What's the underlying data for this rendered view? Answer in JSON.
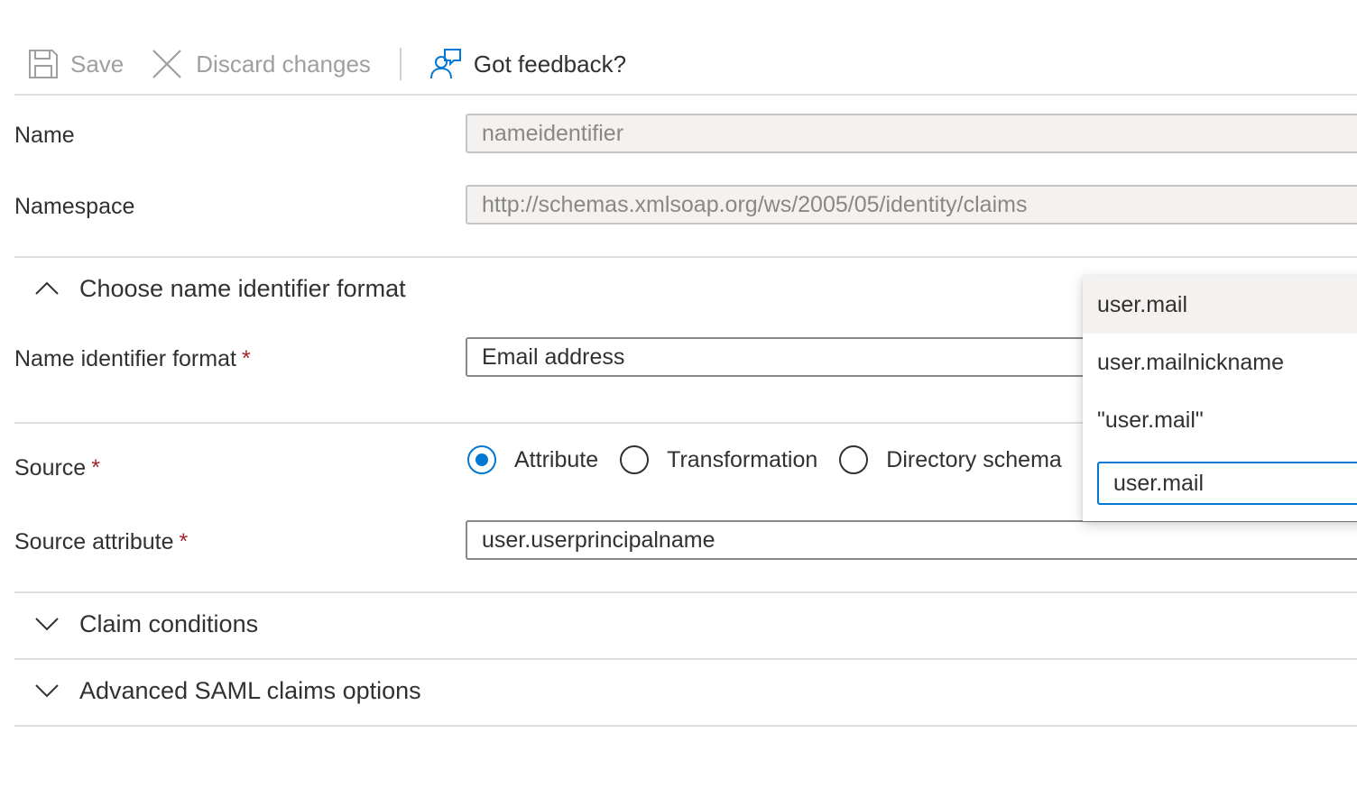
{
  "toolbar": {
    "save_label": "Save",
    "discard_label": "Discard changes",
    "feedback_label": "Got feedback?"
  },
  "form": {
    "name": {
      "label": "Name",
      "value": "nameidentifier"
    },
    "namespace": {
      "label": "Namespace",
      "value": "http://schemas.xmlsoap.org/ws/2005/05/identity/claims"
    },
    "name_id_section": {
      "title": "Choose name identifier format",
      "expanded": true
    },
    "name_id_format": {
      "label": "Name identifier format",
      "required_mark": "*",
      "value": "Email address"
    },
    "source": {
      "label": "Source",
      "required_mark": "*",
      "options": [
        "Attribute",
        "Transformation",
        "Directory schema"
      ],
      "selected": "Attribute"
    },
    "source_attribute": {
      "label": "Source attribute",
      "required_mark": "*",
      "value": "user.userprincipalname"
    },
    "claim_conditions": {
      "title": "Claim conditions",
      "expanded": false
    },
    "advanced_options": {
      "title": "Advanced SAML claims options",
      "expanded": false
    }
  },
  "dropdown": {
    "items": [
      "user.mail",
      "user.mailnickname",
      "\"user.mail\""
    ],
    "input_value": "user.mail"
  },
  "colors": {
    "accent": "#0078d4",
    "required": "#a4262c",
    "disabled_text": "#a19f9d"
  },
  "icons": [
    "save-icon",
    "close-icon",
    "feedback-icon",
    "chevron-up-icon",
    "chevron-down-icon"
  ]
}
